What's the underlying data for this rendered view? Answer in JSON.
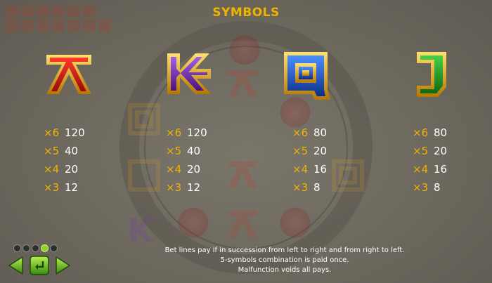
{
  "title": "SYMBOLS",
  "colors": {
    "accent": "#f0b400",
    "text": "#ffffff",
    "background": "#6b675d",
    "active_dot": "#8fd22a"
  },
  "symbols": [
    {
      "icon": "letter-a-symbol-icon",
      "glyph_color": "#d4141c",
      "payouts": [
        {
          "mult": "×6",
          "value": "120"
        },
        {
          "mult": "×5",
          "value": "40"
        },
        {
          "mult": "×4",
          "value": "20"
        },
        {
          "mult": "×3",
          "value": "12"
        }
      ]
    },
    {
      "icon": "letter-k-symbol-icon",
      "glyph_color": "#7a2fb8",
      "payouts": [
        {
          "mult": "×6",
          "value": "120"
        },
        {
          "mult": "×5",
          "value": "40"
        },
        {
          "mult": "×4",
          "value": "20"
        },
        {
          "mult": "×3",
          "value": "12"
        }
      ]
    },
    {
      "icon": "letter-q-symbol-icon",
      "glyph_color": "#1c5fd0",
      "payouts": [
        {
          "mult": "×6",
          "value": "80"
        },
        {
          "mult": "×5",
          "value": "20"
        },
        {
          "mult": "×4",
          "value": "16"
        },
        {
          "mult": "×3",
          "value": "8"
        }
      ]
    },
    {
      "icon": "letter-j-symbol-icon",
      "glyph_color": "#1f9a2a",
      "payouts": [
        {
          "mult": "×6",
          "value": "80"
        },
        {
          "mult": "×5",
          "value": "20"
        },
        {
          "mult": "×4",
          "value": "16"
        },
        {
          "mult": "×3",
          "value": "8"
        }
      ]
    }
  ],
  "footer": {
    "line1": "Bet lines pay if in succession from left to right and from right to left.",
    "line2": "5-symbols combination is paid once.",
    "line3": "Malfunction voids all pays."
  },
  "pagination": {
    "total_pages": 5,
    "current_page": 4
  },
  "nav": {
    "prev_icon": "arrow-left-icon",
    "return_icon": "return-icon",
    "next_icon": "arrow-right-icon"
  }
}
